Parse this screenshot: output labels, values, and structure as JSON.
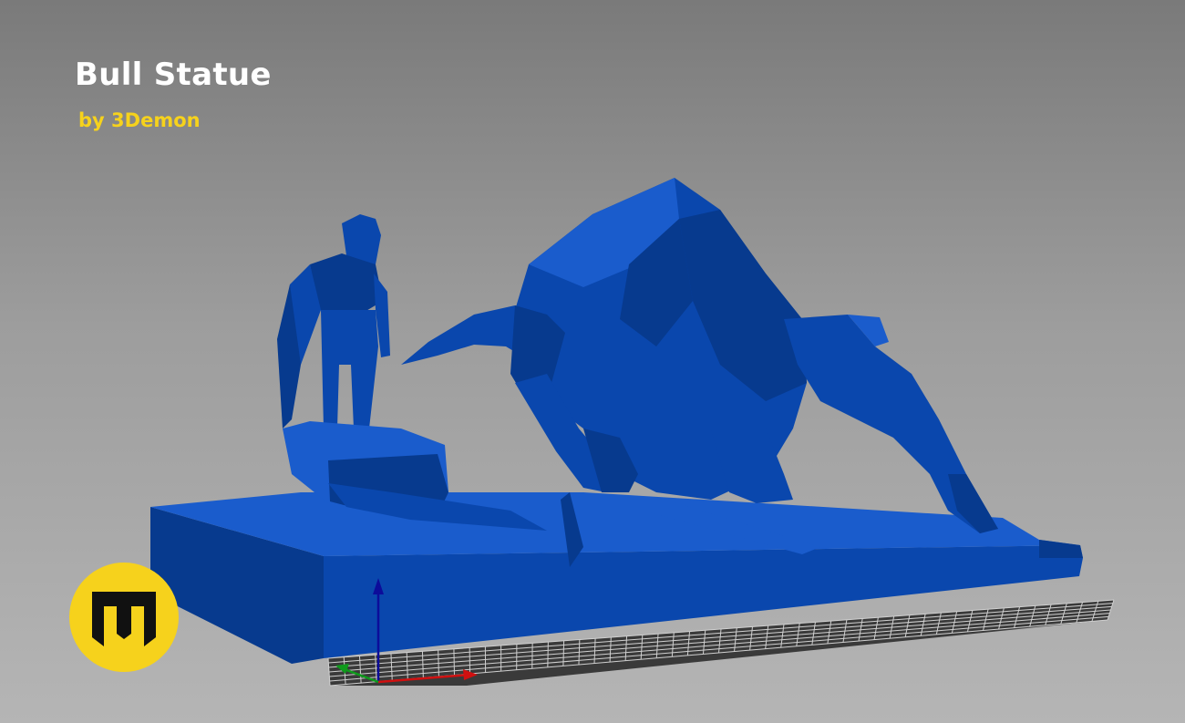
{
  "header": {
    "title": "Bull Statue",
    "subtitle": "by 3Demon"
  },
  "colors": {
    "accent": "#f6d21c",
    "model_main": "#0a47ad",
    "model_dark": "#073a8e",
    "model_light": "#1a5ccc",
    "grid_floor": "#3a3a3a",
    "grid_line": "#d0d0d0",
    "axis_x": "#d01010",
    "axis_y": "#0f9a1c",
    "axis_z": "#0c0c9a"
  },
  "viewport": {
    "model_name": "bull-statue-model",
    "show_build_plate_grid": true,
    "show_axes": true
  },
  "logo": {
    "icon": "3demon-logo-icon"
  }
}
